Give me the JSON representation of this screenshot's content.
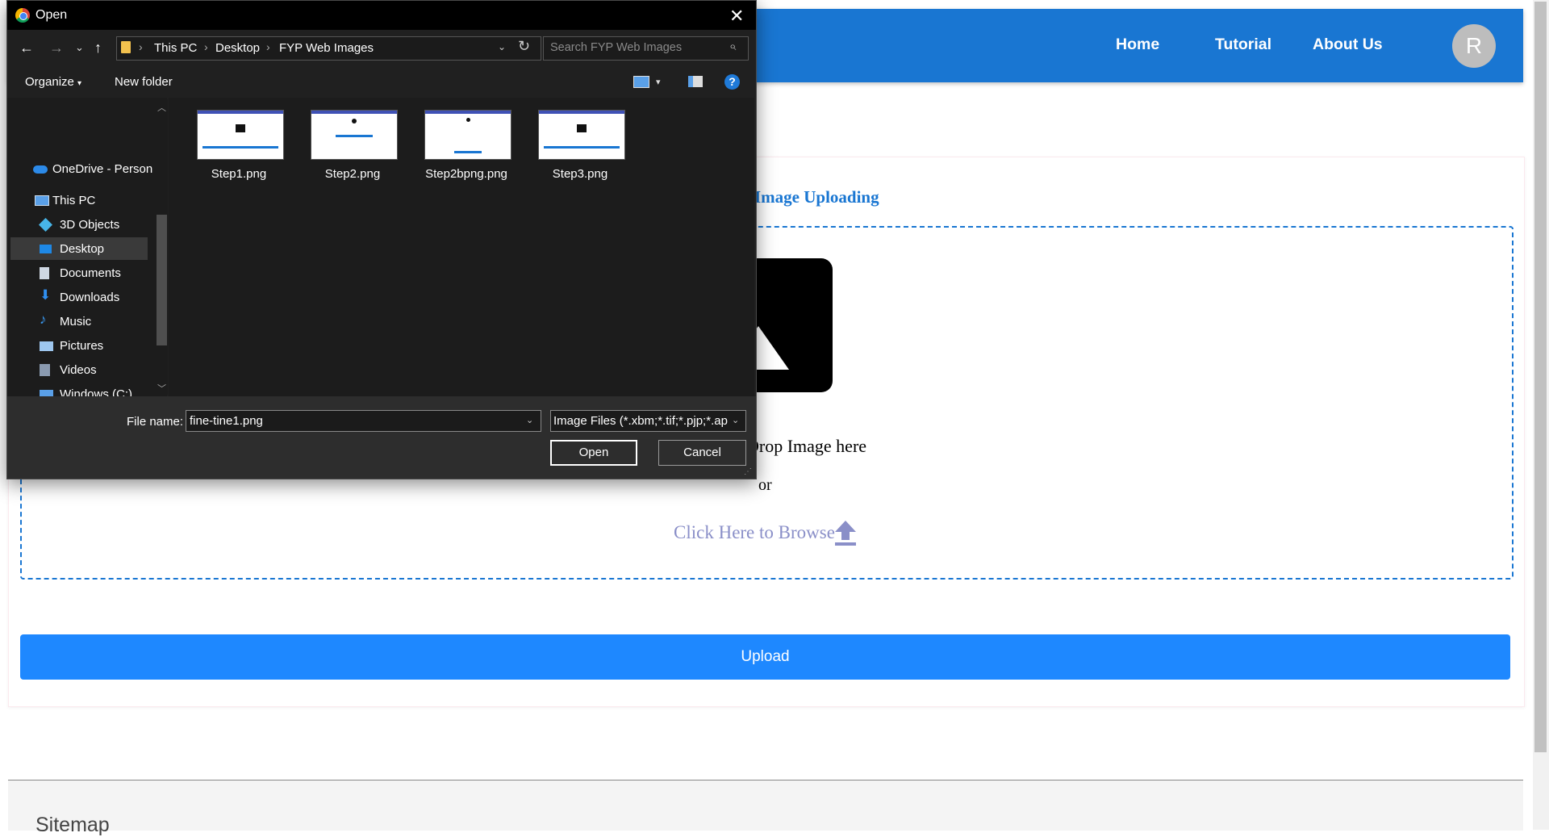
{
  "page": {
    "nav": {
      "home": "Home",
      "tutorial": "Tutorial",
      "about": "About Us",
      "avatar_initial": "R"
    },
    "card_title": "Image Uploading",
    "drop_text": "Drop Image here",
    "or_text": "or",
    "browse_text": "Click Here to Browse",
    "upload_button": "Upload",
    "footer_title": "Sitemap",
    "colors": {
      "navbar": "#1976d2",
      "upload_button": "#1e88ff",
      "browse_text": "#8a8fc8"
    }
  },
  "dialog": {
    "title": "Open",
    "breadcrumb": [
      "This PC",
      "Desktop",
      "FYP Web Images"
    ],
    "search_placeholder": "Search FYP Web Images",
    "organize": "Organize",
    "new_folder": "New folder",
    "help": "?",
    "nav_items": [
      {
        "label": "OneDrive - Person",
        "icon": "onedrive-icon"
      },
      {
        "label": "This PC",
        "icon": "computer-icon"
      },
      {
        "label": "3D Objects",
        "icon": "cube-icon"
      },
      {
        "label": "Desktop",
        "icon": "desktop-icon",
        "selected": true
      },
      {
        "label": "Documents",
        "icon": "document-icon"
      },
      {
        "label": "Downloads",
        "icon": "download-icon"
      },
      {
        "label": "Music",
        "icon": "music-icon"
      },
      {
        "label": "Pictures",
        "icon": "picture-icon"
      },
      {
        "label": "Videos",
        "icon": "video-icon"
      },
      {
        "label": "Windows (C:)",
        "icon": "drive-icon"
      }
    ],
    "files": [
      "Step1.png",
      "Step2.png",
      "Step2bpng.png",
      "Step3.png"
    ],
    "file_name_label": "File name:",
    "file_name_value": "fine-tine1.png",
    "file_type_value": "Image Files (*.xbm;*.tif;*.pjp;*.ap",
    "open_button": "Open",
    "cancel_button": "Cancel"
  }
}
